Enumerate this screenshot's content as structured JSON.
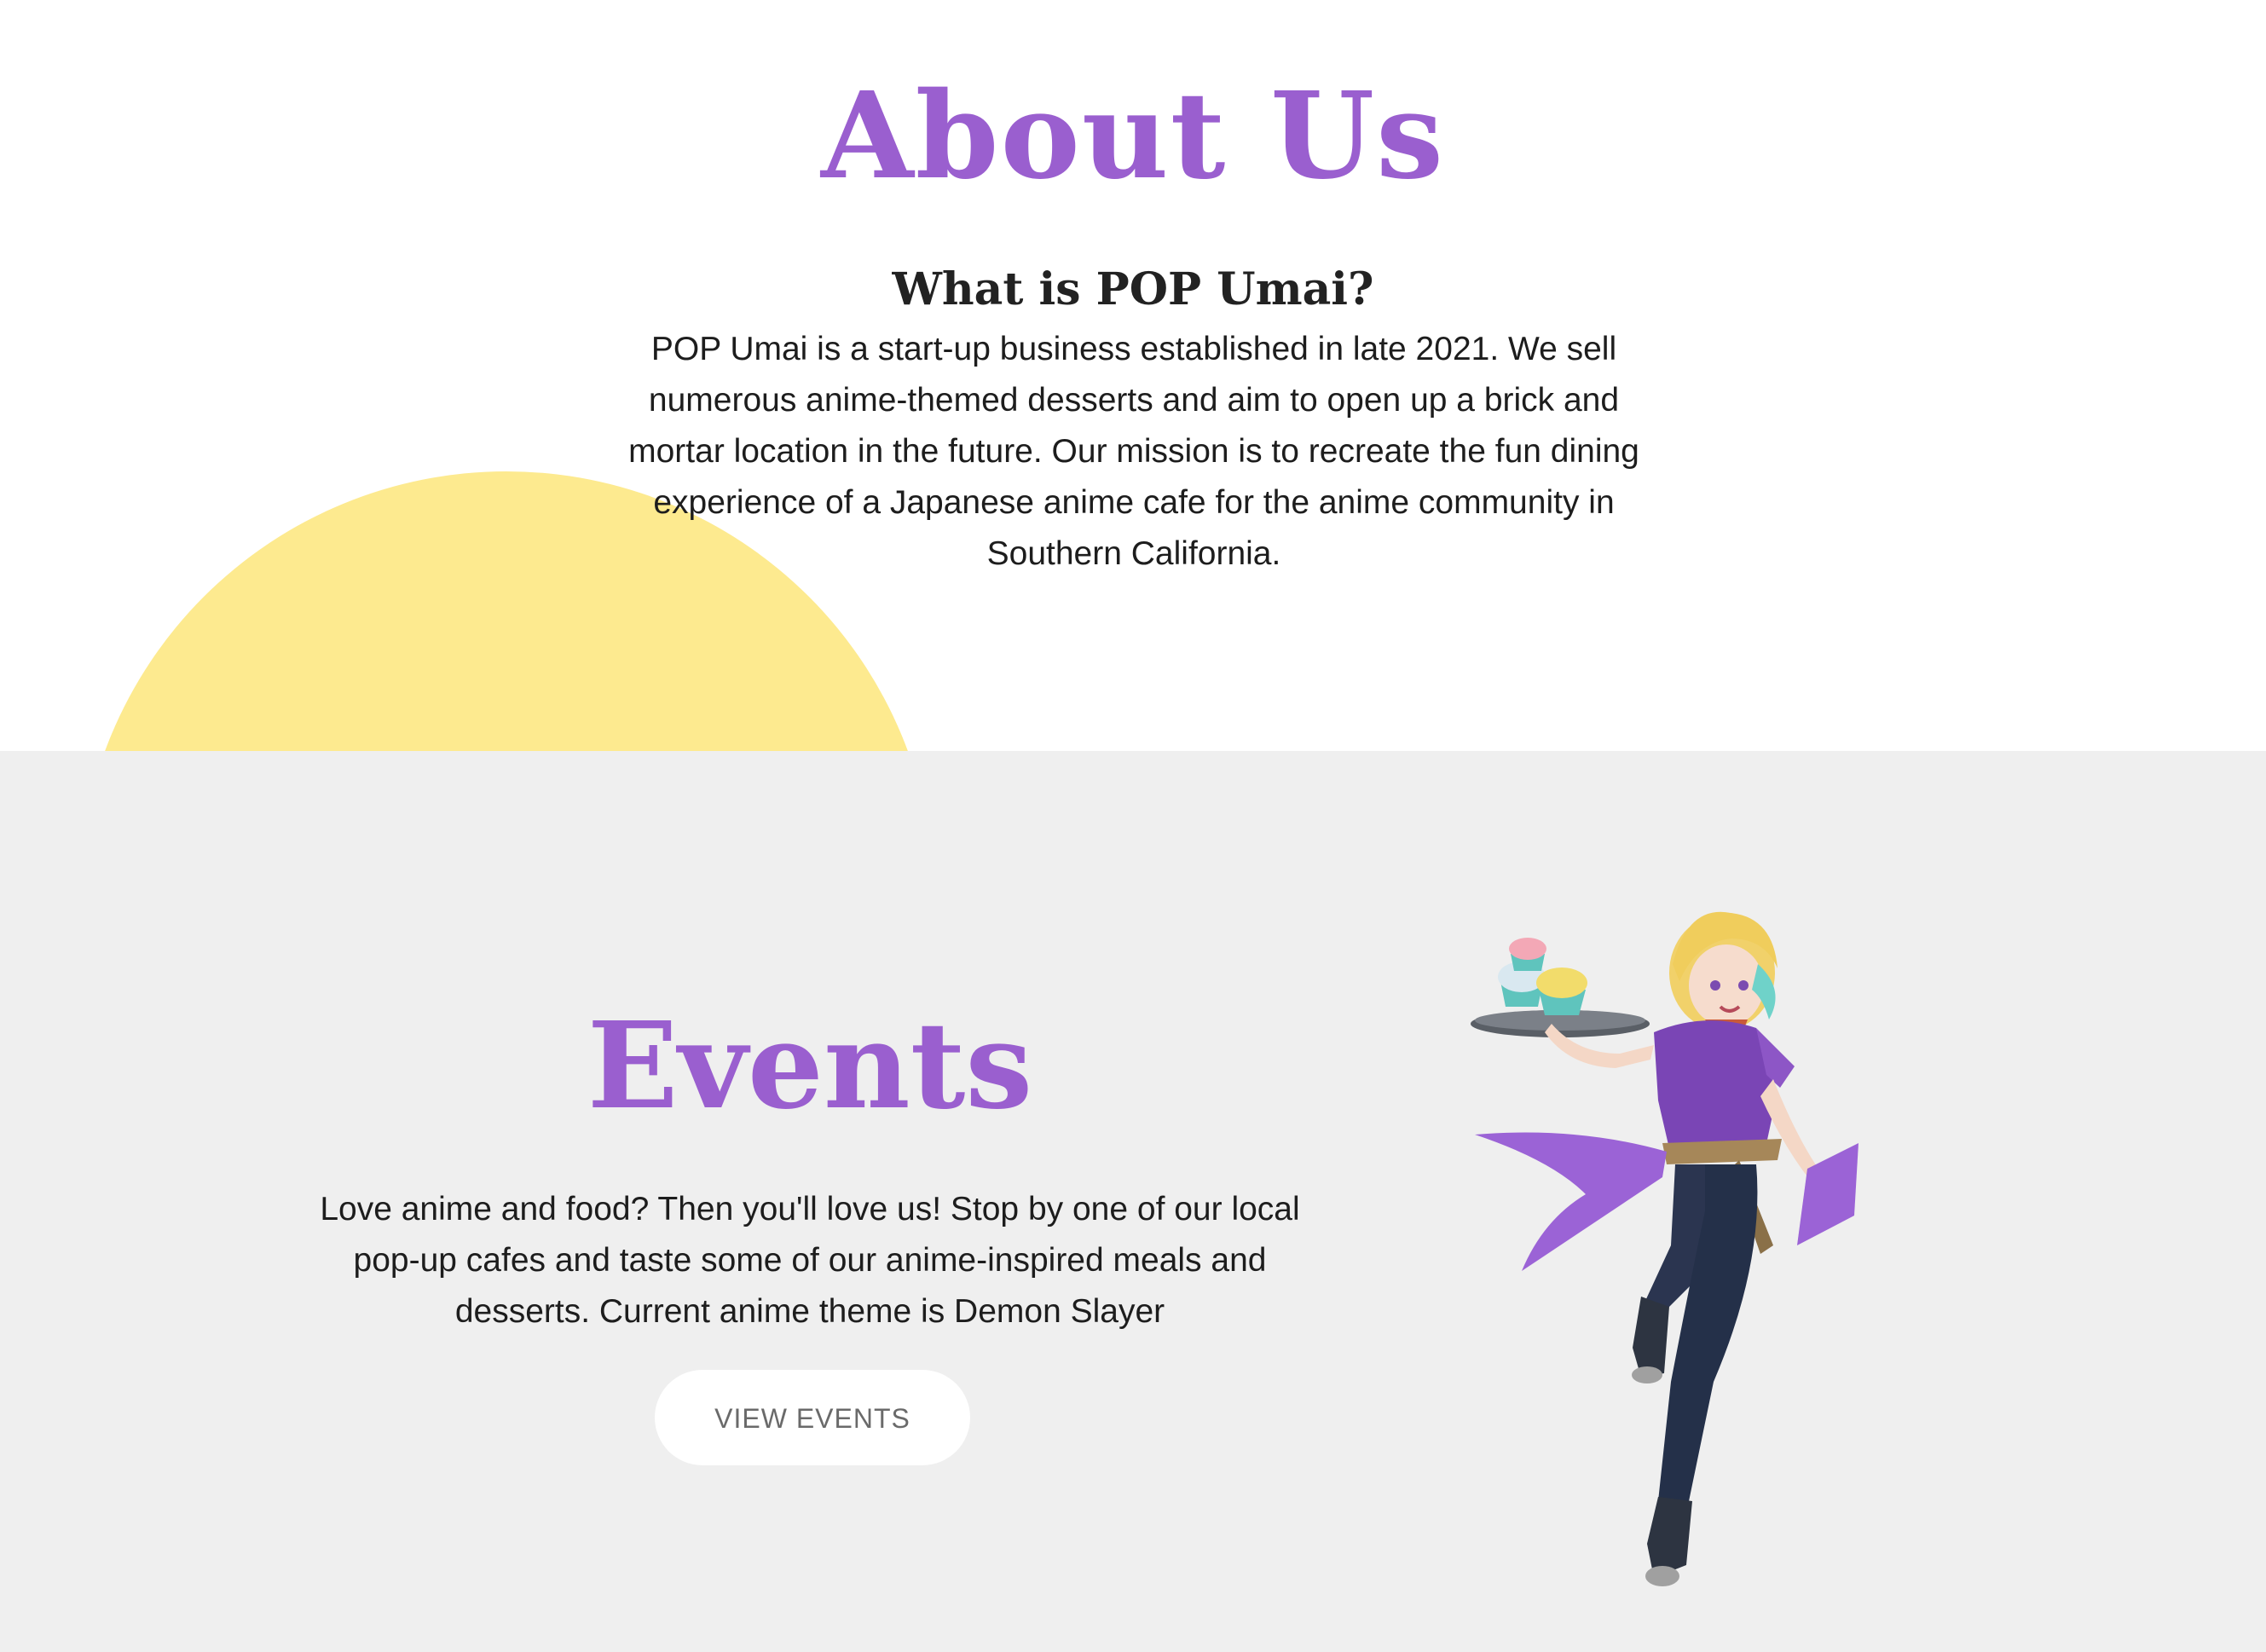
{
  "about": {
    "title": "About Us",
    "subtitle": "What is POP Umai?",
    "body": "POP Umai is a start-up business established in late 2021. We sell numerous anime-themed desserts and aim to open up a brick and mortar location in the future. Our mission is to recreate the fun dining experience of a Japanese anime cafe for the anime community in Southern California."
  },
  "events": {
    "title": "Events",
    "body": "Love anime and food? Then you'll love us! Stop by one of our local pop-up cafes and taste some of our anime-inspired meals and desserts. Current anime theme is Demon Slayer",
    "button_label": "VIEW EVENTS"
  },
  "colors": {
    "accent_purple": "#9a5fcf",
    "sun_yellow": "#fdea8f",
    "events_background": "#efefef"
  },
  "icons": {
    "mascot": "anime-waitress-illustration"
  }
}
